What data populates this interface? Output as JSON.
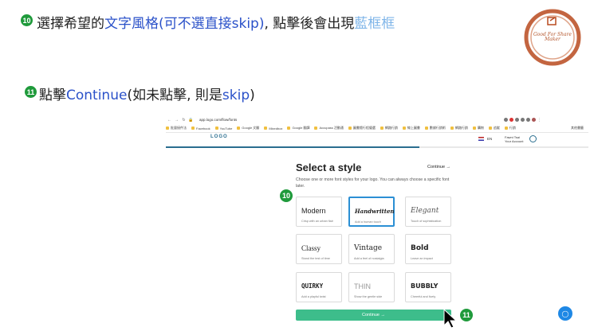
{
  "instructions": {
    "step10_badge": "10",
    "step10_part1": "選擇希望的",
    "step10_part2": "文字風格(可不選直接skip)",
    "step10_part3": ", 點擊後會出現",
    "step10_part4": "藍框框",
    "step11_badge": "11",
    "step11_part1": "點擊",
    "step11_part2": "Continue",
    "step11_part3": "(如未點擊, 則是",
    "step11_part4": "skip",
    "step11_part5": ")"
  },
  "stamp_logo": {
    "line1": "Good For Share",
    "line2": "Maker"
  },
  "browser": {
    "url": "app.logo.com/flow/fonts",
    "bookmarks": [
      "批量接件法",
      "Facebook",
      "YouTube",
      "Google 文翻",
      "Mixedbox",
      "Google 翻譯",
      "Accupass 活動通",
      "圖書館行程優選",
      "網路行銷",
      "線上圖書",
      "數據行銷術",
      "網路行銷",
      "購物",
      "追蹤",
      "行銷"
    ],
    "other_bookmarks": "其他書籤"
  },
  "app": {
    "logo_text": "LOGO",
    "progress_fraction": 0.6,
    "lang": "EN",
    "user_name": "Fawni Tsai",
    "user_sub": "Your Account",
    "title": "Select a style",
    "continue_link": "Continue →",
    "description": "Choose one or more font styles for your logo. You can always choose a specific font later.",
    "styles": [
      {
        "name": "Modern",
        "sub": "Crisp with an urban flair",
        "selected": false
      },
      {
        "name": "Handwritten",
        "sub": "Add a human touch",
        "selected": true
      },
      {
        "name": "Elegant",
        "sub": "Touch of sophistication",
        "selected": false
      },
      {
        "name": "Classy",
        "sub": "Stand the test of time",
        "selected": false
      },
      {
        "name": "Vintage",
        "sub": "Add a feel of nostalgia",
        "selected": false
      },
      {
        "name": "Bold",
        "sub": "Leave an impact",
        "selected": false
      },
      {
        "name": "QUIRKY",
        "sub": "Add a playful twist",
        "selected": false
      },
      {
        "name": "THIN",
        "sub": "Show the gentle side",
        "selected": false
      },
      {
        "name": "BUBBLY",
        "sub": "Cheerful and lively",
        "selected": false
      }
    ],
    "continue_button": "Continue →",
    "overlay_badge_10": "10",
    "overlay_badge_11": "11"
  },
  "colors": {
    "badge_green": "#1f9a3b",
    "instruction_blue": "#2a51c9",
    "instruction_light_blue": "#7fb5e8",
    "selected_border": "#2b8fd4",
    "continue_green": "#3dbd8b"
  }
}
